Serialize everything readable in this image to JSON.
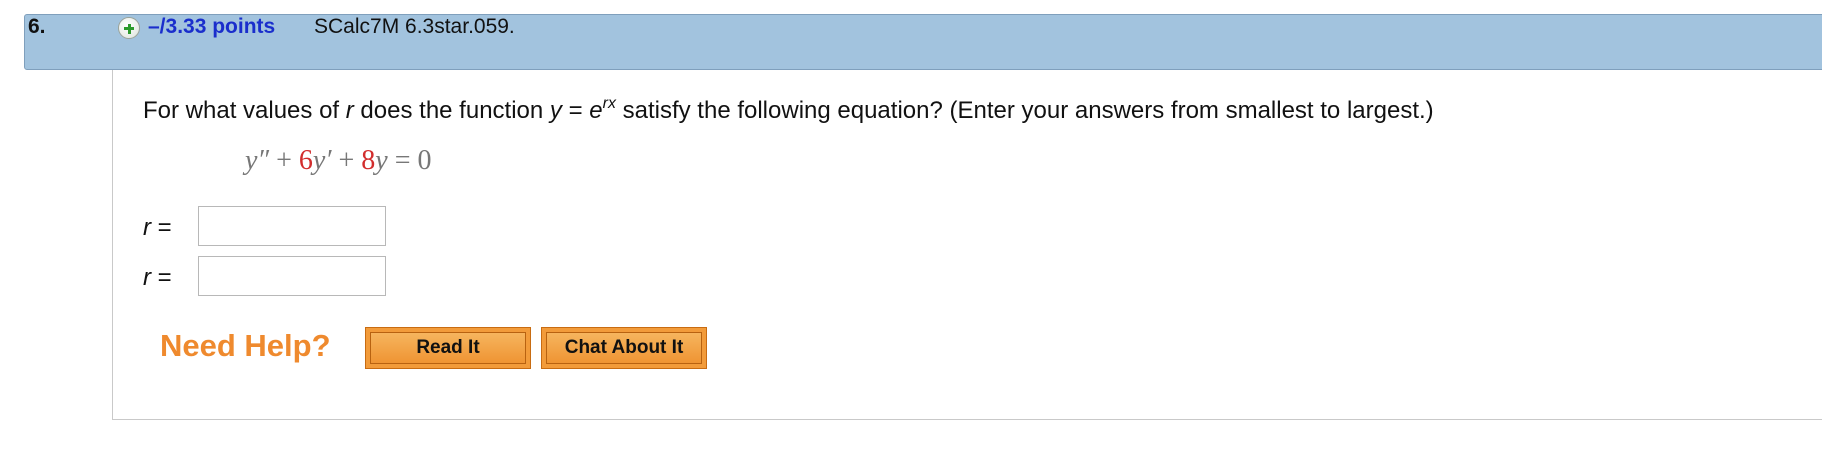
{
  "question": {
    "number": "6.",
    "points": "–/3.33 points",
    "source": "SCalc7M 6.3star.059.",
    "text_before_r": "For what values of ",
    "var_r": "r",
    "text_mid": " does the function ",
    "var_y": "y",
    "equals": " = ",
    "exp_base": "e",
    "exp_power": "rx",
    "text_after": " satisfy the following equation? (Enter your answers from smallest to largest.)"
  },
  "equation": {
    "term1": "y″",
    "plus1": " + ",
    "coef1": "6",
    "term2": "y′",
    "plus2": " + ",
    "coef2": "8",
    "term3": "y",
    "rhs": " = 0"
  },
  "answers": [
    {
      "label_var": "r",
      "label_eq": " =",
      "value": ""
    },
    {
      "label_var": "r",
      "label_eq": " =",
      "value": ""
    }
  ],
  "help": {
    "title": "Need Help?",
    "read_it": "Read It",
    "chat_about_it": "Chat About It"
  },
  "colors": {
    "header_bg": "#a2c3de",
    "points_blue": "#1a2ecc",
    "help_orange": "#ef8a2e",
    "coef_red": "#d22d2d"
  }
}
